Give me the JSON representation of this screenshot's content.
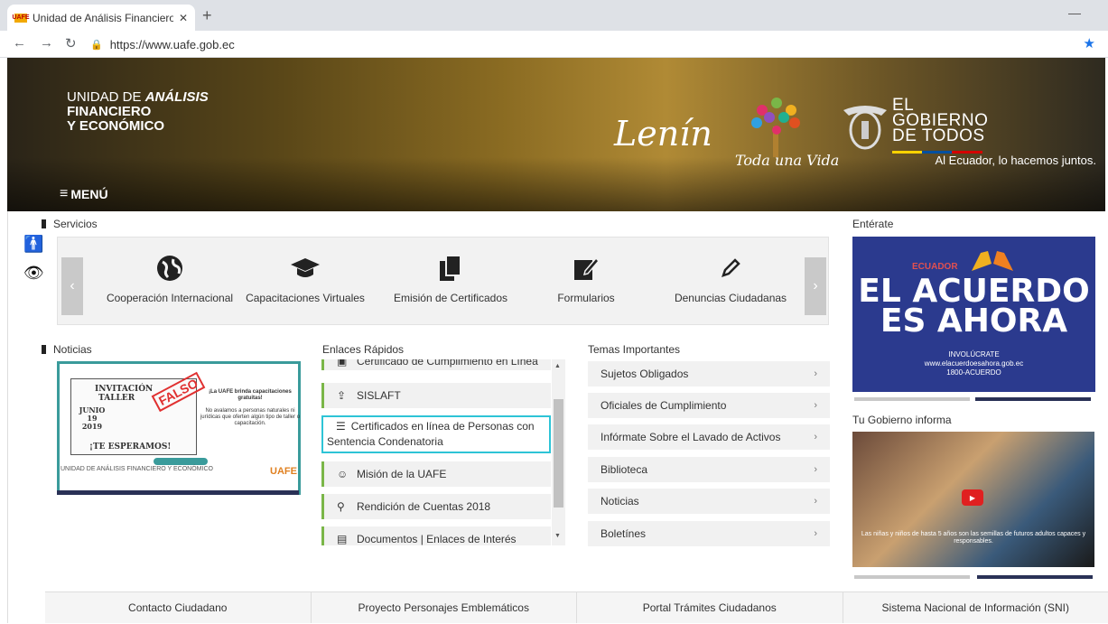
{
  "browser": {
    "tab_title": "Unidad de Análisis Financiero y E",
    "tab_close": "✕",
    "new_tab": "+",
    "url": "https://www.uafe.gob.ec",
    "favicon": "UAFE"
  },
  "banner": {
    "brand_line1_pre": "UNIDAD DE ",
    "brand_line1_bold": "ANÁLISIS",
    "brand_line2": "FINANCIERO",
    "brand_line3": "Y ECONÓMICO",
    "lenin": "Lenín",
    "toda": "Toda una Vida",
    "gob_line1": "EL",
    "gob_line2": "GOBIERNO",
    "gob_line3": "DE TODOS",
    "tagline": "Al Ecuador, lo hacemos juntos.",
    "menu": "MENÚ"
  },
  "sections": {
    "servicios": "Servicios",
    "noticias": "Noticias",
    "enlaces": "Enlaces Rápidos",
    "temas": "Temas Importantes",
    "enterate": "Entérate",
    "gobierno": "Tu Gobierno informa"
  },
  "services": [
    {
      "label": "Cooperación Internacional",
      "icon": "globe-icon"
    },
    {
      "label": "Capacitaciones Virtuales",
      "icon": "graduation-cap-icon"
    },
    {
      "label": "Emisión de Certificados",
      "icon": "documents-icon"
    },
    {
      "label": "Formularios",
      "icon": "edit-form-icon"
    },
    {
      "label": "Denuncias Ciudadanas",
      "icon": "pencil-icon"
    }
  ],
  "news": {
    "inv_title1": "INVITACIÓN",
    "inv_title2": "TALLER",
    "inv_date": "JUNIO 19 2019",
    "inv_cta": "¡TE ESPERAMOS!",
    "stamp": "FALSO",
    "right_title": "¡La UAFE brinda capacitaciones gratuitas!",
    "right_body": "No avalamos a personas naturales ni jurídicas que oferten algún tipo de taller o capacitación.",
    "foot_left": "UNIDAD DE ANÁLISIS FINANCIERO Y ECONÓMICO",
    "foot_logo": "UAFE"
  },
  "links": [
    {
      "label": "Certificado de Cumplimiento en Línea",
      "icon": "document-icon"
    },
    {
      "label": "SISLAFT",
      "icon": "upload-icon"
    },
    {
      "label": "Certificados en línea de Personas con Sentencia Condenatoria",
      "icon": "list-icon"
    },
    {
      "label": "Misión de la UAFE",
      "icon": "smile-icon"
    },
    {
      "label": "Rendición de Cuentas 2018",
      "icon": "search-icon"
    },
    {
      "label": "Documentos | Enlaces de Interés",
      "icon": "folder-icon"
    }
  ],
  "temas": [
    "Sujetos Obligados",
    "Oficiales de Cumplimiento",
    "Infórmate Sobre el Lavado de Activos",
    "Biblioteca",
    "Noticias",
    "Boletínes"
  ],
  "ad": {
    "country": "ECUADOR",
    "headline1": "EL ACUERDO",
    "headline2": "ES AHORA",
    "sub1": "INVOLÚCRATE",
    "sub2": "www.elacuerdoesahora.gob.ec",
    "sub3": "1800-ACUERDO"
  },
  "video": {
    "caption": "Las niñas y niños de hasta 5 años son las semillas de futuros adultos capaces y responsables."
  },
  "footer": [
    "Contacto Ciudadano",
    "Proyecto Personajes Emblemáticos",
    "Portal Trámites Ciudadanos",
    "Sistema Nacional de Información (SNI)"
  ],
  "colors": {
    "accent_green": "#7ab648",
    "teal": "#3a9b9b",
    "navy": "#2a3156",
    "ad_blue": "#2b3a8e"
  }
}
